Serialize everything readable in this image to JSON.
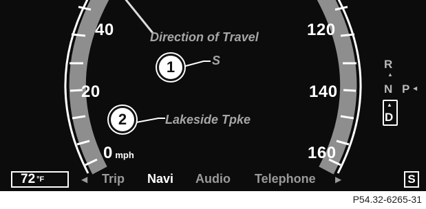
{
  "speedometer": {
    "left_labels": [
      "40",
      "20",
      "0"
    ],
    "left_unit": "mph",
    "right_labels": [
      "120",
      "140",
      "160"
    ]
  },
  "navigation": {
    "heading_label": "Direction of Travel",
    "heading_value": "S",
    "road_name": "Lakeside Tpke",
    "callout_1": "1",
    "callout_2": "2"
  },
  "transmission": {
    "gears": [
      "R",
      "N",
      "P",
      "D"
    ],
    "selected": "D"
  },
  "status_bar": {
    "temperature": "72",
    "temperature_unit": "°F",
    "menu": [
      "Trip",
      "Navi",
      "Audio",
      "Telephone"
    ],
    "active_menu": "Navi",
    "mode_indicator": "S"
  },
  "image_code": "P54.32-6265-31",
  "colors": {
    "background": "#0c0c0c",
    "gauge_arc": "#8a8a8a",
    "text_primary": "#ffffff",
    "text_secondary": "#a6a6a6"
  }
}
